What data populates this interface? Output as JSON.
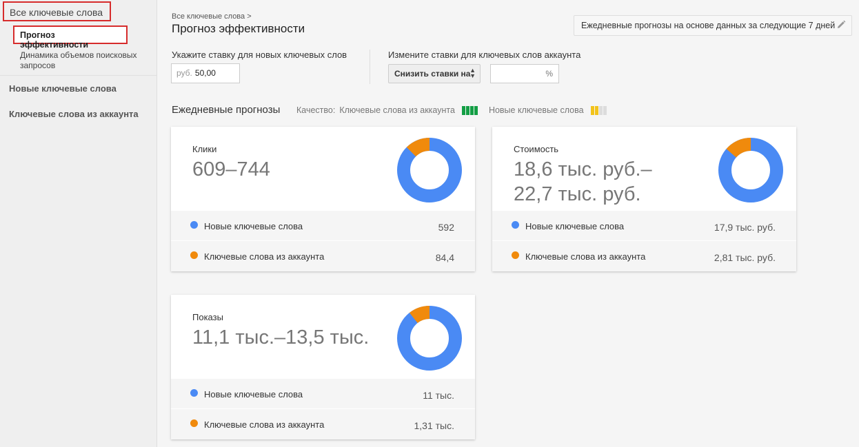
{
  "sidebar": {
    "all_keywords": "Все ключевые слова",
    "forecast": "Прогноз эффективности",
    "dynamics": "Динамика объемов поисковых запросов",
    "new_keywords": "Новые ключевые слова",
    "account_keywords": "Ключевые слова из аккаунта"
  },
  "header": {
    "breadcrumb": "Все ключевые слова >",
    "title": "Прогноз эффективности",
    "forecast_button": "Ежедневные прогнозы на основе данных за следующие 7 дней",
    "forecast_button_icon": "pencil-icon"
  },
  "bid": {
    "label": "Укажите ставку для новых ключевых слов",
    "unit": "руб.",
    "value": "50,00"
  },
  "change": {
    "label": "Измените ставки для ключевых слов аккаунта",
    "select_value": "Снизить ставки на",
    "percent_placeholder": "%"
  },
  "daily": {
    "title": "Ежедневные прогнозы",
    "quality_label": "Качество:",
    "quality_account": "Ключевые слова из аккаунта",
    "quality_new": "Новые ключевые слова",
    "quality_account_level": 4,
    "quality_new_level": 2,
    "quality_scale": 4
  },
  "colors": {
    "blue": "#4a8af4",
    "orange": "#f08a0c",
    "green": "#139e45",
    "yellow": "#f2c31b",
    "grey": "#dcdcdc"
  },
  "cards": {
    "clicks": {
      "label": "Клики",
      "value": "609–744",
      "new_label": "Новые ключевые слова",
      "new_value": "592",
      "account_label": "Ключевые слова из аккаунта",
      "account_value": "84,4",
      "new_share": 0.875
    },
    "cost": {
      "label": "Стоимость",
      "value_line1": "18,6 тыс. руб.–",
      "value_line2": "22,7 тыс. руб.",
      "new_label": "Новые ключевые слова",
      "new_value": "17,9 тыс. руб.",
      "account_label": "Ключевые слова из аккаунта",
      "account_value": "2,81 тыс. руб.",
      "new_share": 0.864
    },
    "impressions": {
      "label": "Показы",
      "value": "11,1 тыс.–13,5 тыс.",
      "new_label": "Новые ключевые слова",
      "new_value": "11 тыс.",
      "account_label": "Ключевые слова из аккаунта",
      "account_value": "1,31 тыс.",
      "new_share": 0.894
    }
  }
}
